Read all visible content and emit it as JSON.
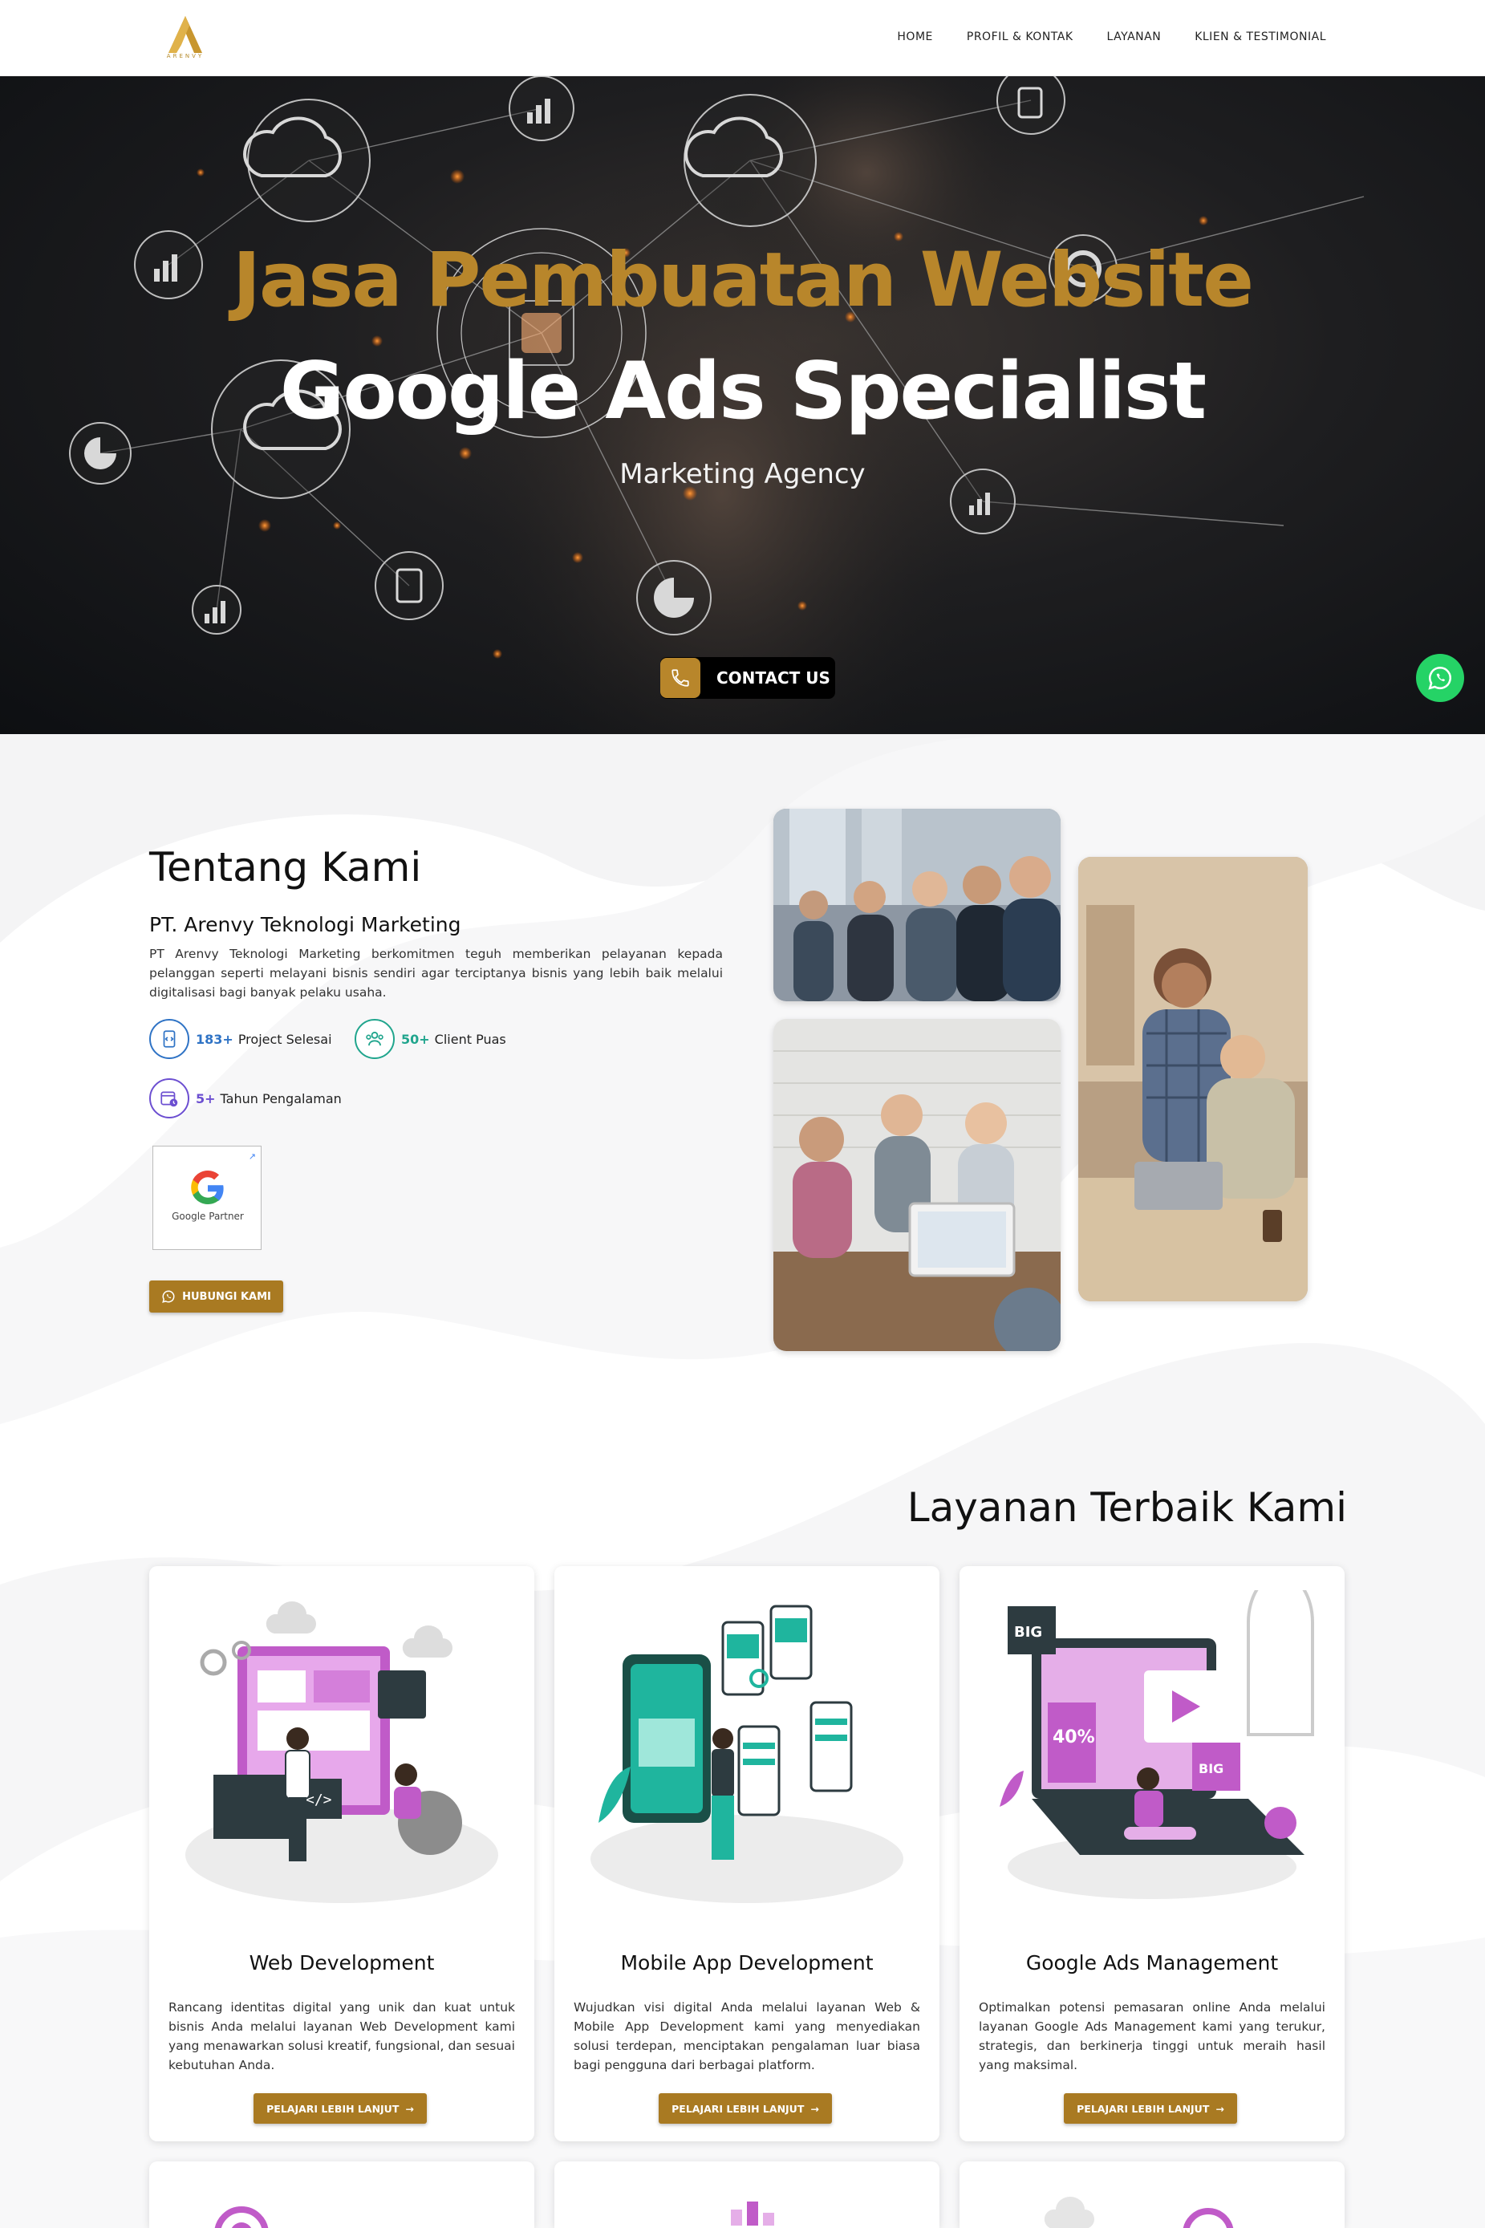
{
  "nav": {
    "logo_sub": "ARENVY",
    "items": [
      {
        "label": "HOME"
      },
      {
        "label": "PROFIL & KONTAK"
      },
      {
        "label": "LAYANAN"
      },
      {
        "label": "KLIEN & TESTIMONIAL"
      }
    ]
  },
  "hero": {
    "title_line1": "Jasa Pembuatan Website",
    "title_line2": "Google Ads Specialist",
    "subtitle": "Marketing Agency",
    "cta_label": "CONTACT US"
  },
  "about": {
    "heading": "Tentang Kami",
    "company": "PT. Arenvy Teknologi Marketing",
    "description": "PT Arenvy Teknologi Marketing berkomitmen teguh memberikan pelayanan kepada pelanggan seperti melayani bisnis sendiri agar terciptanya bisnis yang lebih baik melalui digitalisasi bagi banyak pelaku usaha.",
    "stats": [
      {
        "value": "183+",
        "label": "Project Selesai",
        "color": "#2f73c5"
      },
      {
        "value": "50+",
        "label": "Client Puas",
        "color": "#20a58d"
      },
      {
        "value": "5+",
        "label": "Tahun Pengalaman",
        "color": "#6c4fd1"
      }
    ],
    "partner_label": "Google Partner",
    "contact_button": "HUBUNGI KAMI"
  },
  "services": {
    "heading": "Layanan Terbaik Kami",
    "cards": [
      {
        "title": "Web Development",
        "description": "Rancang identitas digital yang unik dan kuat untuk bisnis Anda melalui layanan Web Development kami yang menawarkan solusi kreatif, fungsional, dan sesuai kebutuhan Anda.",
        "button": "PELAJARI LEBIH LANJUT"
      },
      {
        "title": "Mobile App Development",
        "description": "Wujudkan visi digital Anda melalui layanan Web & Mobile App Development kami yang menyediakan solusi terdepan, menciptakan pengalaman luar biasa bagi pengguna dari berbagai platform.",
        "button": "PELAJARI LEBIH LANJUT"
      },
      {
        "title": "Google Ads Management",
        "description": "Optimalkan potensi pemasaran online Anda melalui layanan Google Ads Management kami yang terukur, strategis, dan berkinerja tinggi untuk meraih hasil yang maksimal.",
        "button": "PELAJARI LEBIH LANJUT"
      }
    ]
  },
  "colors": {
    "gold": "#b8862b",
    "button_gold": "#a97a22",
    "whatsapp": "#25d366",
    "accent_pink": "#c05bc8",
    "accent_teal": "#1fb59e"
  }
}
